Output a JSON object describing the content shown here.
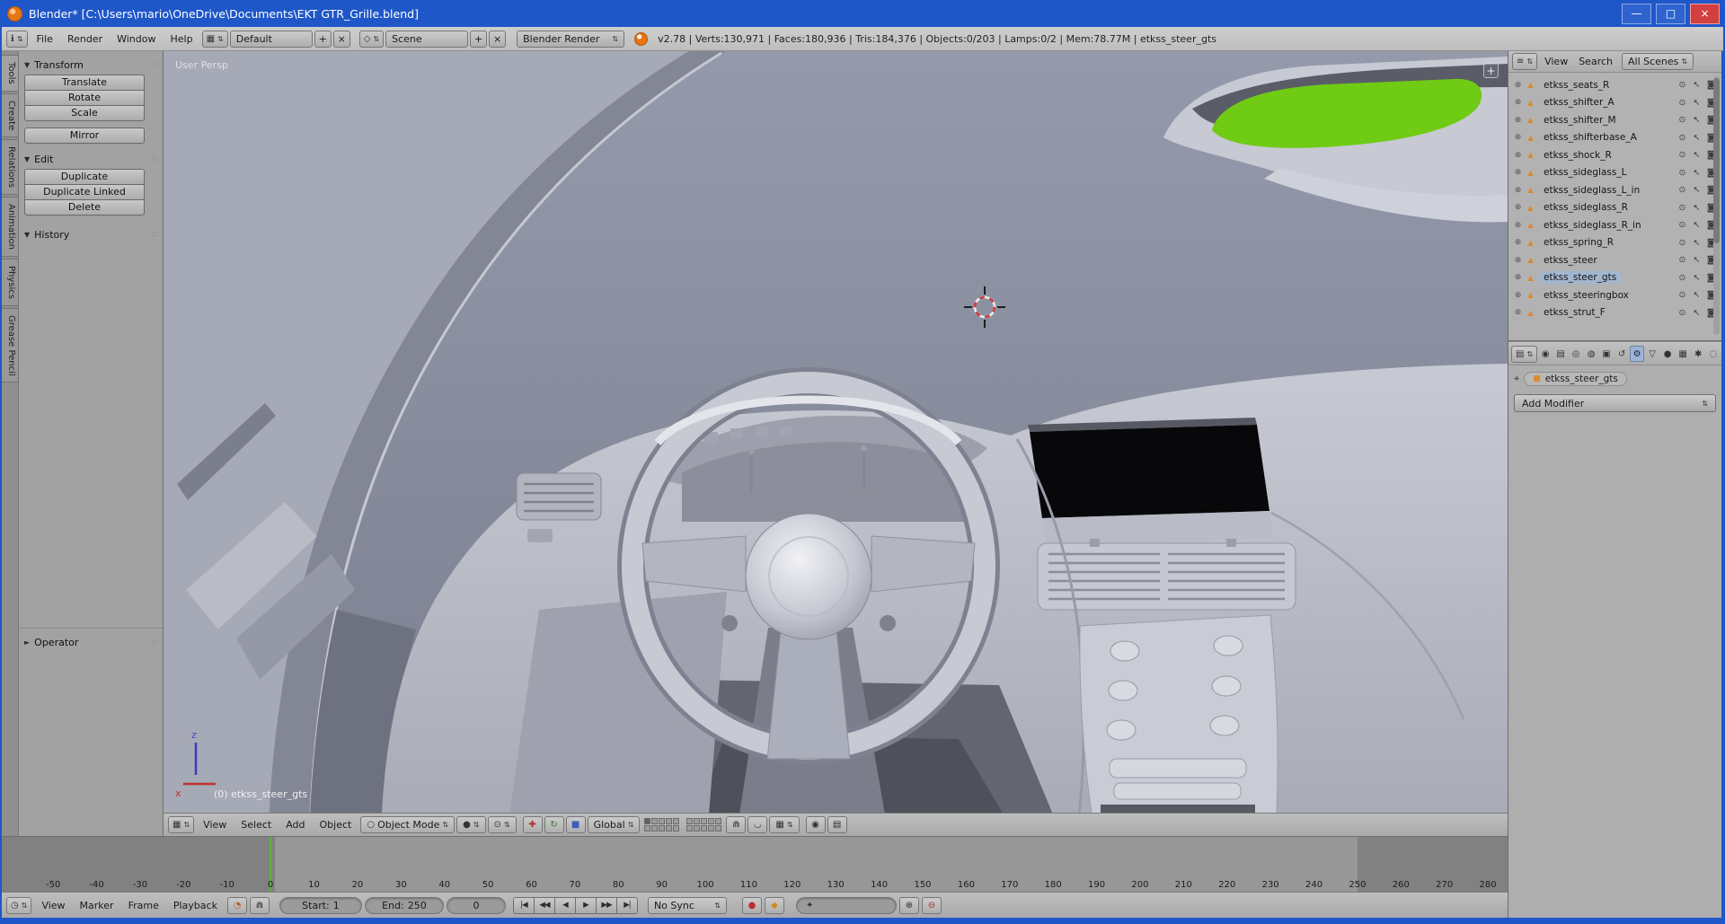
{
  "window": {
    "title": "Blender* [C:\\Users\\mario\\OneDrive\\Documents\\EKT GTR_Grille.blend]",
    "minimize_glyph": "—",
    "maximize_glyph": "□",
    "close_glyph": "×"
  },
  "icons": {
    "updown": "⇅",
    "plus": "+",
    "x": "×",
    "grid": "▦",
    "info": "ℹ",
    "clock": "◷",
    "list": "≡",
    "props": "▤",
    "scene_diamond": "◇",
    "tri_open": "▼",
    "tri_closed": "►",
    "dots": "∷",
    "mode_circle": "○",
    "shade_circle": "●",
    "pivot": "⊙",
    "manip_t": "✚",
    "manip_r": "↻",
    "manip_s": "■",
    "lock": "⋒",
    "magnet": "◡",
    "render_cam": "◉",
    "render_seq": "▤",
    "eye": "⊙",
    "cursor": "↖",
    "camera": "◙",
    "expand": "⊕",
    "mesh": "▲",
    "rec": "●",
    "autokey": "◆",
    "keyset": "✦",
    "key_add": "⊕",
    "key_del": "⊖",
    "preview": "◔",
    "pin": "⌖",
    "cube": "■",
    "expand_region": "+"
  },
  "infobar": {
    "menus": [
      "File",
      "Render",
      "Window",
      "Help"
    ],
    "layout_value": "Default",
    "scene_value": "Scene",
    "engine_value": "Blender Render",
    "stats": "v2.78 | Verts:130,971 | Faces:180,936 | Tris:184,376 | Objects:0/203 | Lamps:0/2 | Mem:78.77M | etkss_steer_gts"
  },
  "toolshelf": {
    "tabs": [
      {
        "label": "Tools",
        "active": true
      },
      {
        "label": "Create"
      },
      {
        "label": "Relations"
      },
      {
        "label": "Animation"
      },
      {
        "label": "Physics"
      },
      {
        "label": "Grease Pencil"
      }
    ],
    "transform_panel": {
      "title": "Transform",
      "buttons": [
        "Translate",
        "Rotate",
        "Scale"
      ]
    },
    "mirror_buttons": [
      "Mirror"
    ],
    "edit_panel": {
      "title": "Edit",
      "buttons": [
        "Duplicate",
        "Duplicate Linked",
        "Delete"
      ]
    },
    "history_title": "History",
    "operator_title": "Operator"
  },
  "viewport": {
    "view_label": "User Persp",
    "object_label": "(0) etkss_steer_gts",
    "axis_x": "x",
    "axis_z": "z",
    "header": {
      "menus": [
        "View",
        "Select",
        "Add",
        "Object"
      ],
      "mode": "Object Mode",
      "orientation": "Global",
      "layers1": [
        {
          "active": true
        },
        {},
        {},
        {},
        {},
        {},
        {},
        {},
        {},
        {}
      ],
      "layers2": [
        {},
        {},
        {},
        {},
        {},
        {},
        {},
        {},
        {},
        {}
      ]
    }
  },
  "outliner": {
    "menus": [
      "View",
      "Search"
    ],
    "display_mode": "All Scenes",
    "items": [
      {
        "name": "etkss_seats_R"
      },
      {
        "name": "etkss_shifter_A"
      },
      {
        "name": "etkss_shifter_M"
      },
      {
        "name": "etkss_shifterbase_A"
      },
      {
        "name": "etkss_shock_R"
      },
      {
        "name": "etkss_sideglass_L"
      },
      {
        "name": "etkss_sideglass_L_in"
      },
      {
        "name": "etkss_sideglass_R"
      },
      {
        "name": "etkss_sideglass_R_in"
      },
      {
        "name": "etkss_spring_R"
      },
      {
        "name": "etkss_steer"
      },
      {
        "name": "etkss_steer_gts",
        "selected": true
      },
      {
        "name": "etkss_steeringbox"
      },
      {
        "name": "etkss_strut_F"
      }
    ]
  },
  "properties": {
    "tabs": [
      {
        "name": "render",
        "glyph": "◉"
      },
      {
        "name": "render-layers",
        "glyph": "▤"
      },
      {
        "name": "scene",
        "glyph": "◎"
      },
      {
        "name": "world",
        "glyph": "◍"
      },
      {
        "name": "object",
        "glyph": "▣"
      },
      {
        "name": "constraints",
        "glyph": "↺"
      },
      {
        "name": "modifiers",
        "glyph": "⚙",
        "active": true
      },
      {
        "name": "object-data",
        "glyph": "▽"
      },
      {
        "name": "material",
        "glyph": "●"
      },
      {
        "name": "texture",
        "glyph": "▦"
      },
      {
        "name": "particles",
        "glyph": "✱"
      },
      {
        "name": "physics",
        "glyph": "◌"
      }
    ],
    "active_object": "etkss_steer_gts",
    "add_modifier_label": "Add Modifier"
  },
  "timeline": {
    "ticks": [
      "-50",
      "-40",
      "-30",
      "-20",
      "-10",
      "0",
      "10",
      "20",
      "30",
      "40",
      "50",
      "60",
      "70",
      "80",
      "90",
      "100",
      "110",
      "120",
      "130",
      "140",
      "150",
      "160",
      "170",
      "180",
      "190",
      "200",
      "210",
      "220",
      "230",
      "240",
      "250",
      "260",
      "270",
      "280"
    ],
    "header": {
      "menus": [
        "View",
        "Marker",
        "Frame",
        "Playback"
      ],
      "start_label": "Start:",
      "start_value": "1",
      "end_label": "End:",
      "end_value": "250",
      "current_frame": "0",
      "sync_mode": "No Sync",
      "playback": [
        "|◀",
        "◀◀",
        "◀",
        "▶",
        "▶▶",
        "▶|"
      ]
    }
  }
}
